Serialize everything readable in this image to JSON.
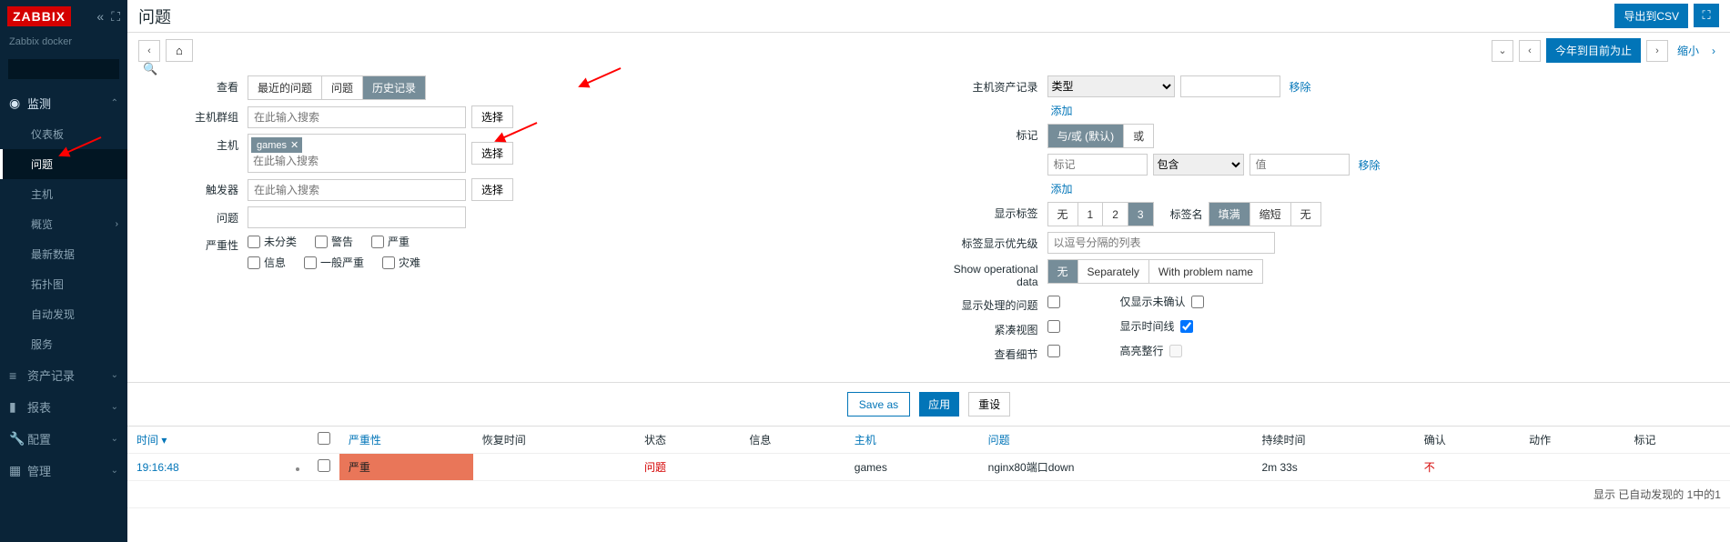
{
  "logo": "ZABBIX",
  "subtitle": "Zabbix docker",
  "sidebar": {
    "sections": [
      {
        "icon": "◉",
        "label": "监测",
        "open": true,
        "items": [
          "仪表板",
          "问题",
          "主机",
          "概览",
          "最新数据",
          "拓扑图",
          "自动发现",
          "服务"
        ],
        "selected": 1
      },
      {
        "icon": "≡",
        "label": "资产记录"
      },
      {
        "icon": "▮",
        "label": "报表"
      },
      {
        "icon": "🔧",
        "label": "配置"
      },
      {
        "icon": "▦",
        "label": "管理"
      }
    ]
  },
  "page": {
    "title": "问题",
    "export_btn": "导出到CSV",
    "timerange": "今年到目前为止",
    "zoomout": "缩小"
  },
  "filter": {
    "view_lbl": "查看",
    "view_opts": [
      "最近的问题",
      "问题",
      "历史记录"
    ],
    "view_sel": 2,
    "hostgroup_lbl": "主机群组",
    "hostgroup_ph": "在此输入搜索",
    "select_btn": "选择",
    "host_lbl": "主机",
    "host_tag": "games",
    "host_ph": "在此输入搜索",
    "trigger_lbl": "触发器",
    "trigger_ph": "在此输入搜索",
    "problem_lbl": "问题",
    "severity_lbl": "严重性",
    "sev_opts": [
      "未分类",
      "警告",
      "严重",
      "信息",
      "一般严重",
      "灾难"
    ],
    "inventory_lbl": "主机资产记录",
    "inventory_type": "类型",
    "remove_lbl": "移除",
    "add_lbl": "添加",
    "tags_lbl": "标记",
    "tag_mode_opts": [
      "与/或 (默认)",
      "或"
    ],
    "tag_mode_sel": 0,
    "tag_name_ph": "标记",
    "tag_op": "包含",
    "tag_val_ph": "值",
    "show_tags_lbl": "显示标签",
    "show_tags_opts": [
      "无",
      "1",
      "2",
      "3"
    ],
    "show_tags_sel": 3,
    "tag_name_lbl": "标签名",
    "tag_name_opts": [
      "填满",
      "缩短",
      "无"
    ],
    "tag_name_sel": 0,
    "tag_prio_lbl": "标签显示优先级",
    "tag_prio_ph": "以逗号分隔的列表",
    "opdata_lbl": "Show operational data",
    "opdata_opts": [
      "无",
      "Separately",
      "With problem name"
    ],
    "opdata_sel": 0,
    "suppressed_lbl": "显示处理的问题",
    "unack_lbl": "仅显示未确认",
    "compact_lbl": "紧凑视图",
    "timeline_lbl": "显示时间线",
    "timeline_checked": true,
    "details_lbl": "查看细节",
    "highlight_lbl": "高亮整行",
    "save_as": "Save as",
    "apply": "应用",
    "reset": "重设"
  },
  "table": {
    "headers": {
      "time": "时间",
      "severity": "严重性",
      "recovery": "恢复时间",
      "status": "状态",
      "info": "信息",
      "host": "主机",
      "problem": "问题",
      "duration": "持续时间",
      "ack": "确认",
      "actions": "动作",
      "tags": "标记"
    },
    "rows": [
      {
        "time": "19:16:48",
        "severity": "严重",
        "status": "问题",
        "host": "games",
        "problem": "nginx80端口down",
        "duration": "2m 33s",
        "ack": "不"
      }
    ],
    "footer": "显示 已自动发现的 1中的1"
  }
}
